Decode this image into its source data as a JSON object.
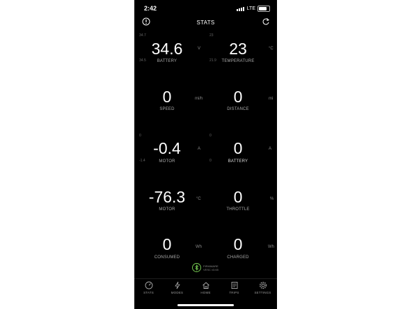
{
  "status": {
    "time": "2:42",
    "network": "LTE"
  },
  "header": {
    "title": "STATS"
  },
  "metrics": {
    "battery_voltage": {
      "value": "34.6",
      "label": "BATTERY",
      "unit": "V",
      "max": "34.7",
      "min": "34.5"
    },
    "temperature": {
      "value": "23",
      "label": "TEMPERATURE",
      "unit": "°C",
      "max": "23",
      "min": "21.9"
    },
    "speed": {
      "value": "0",
      "label": "SPEED",
      "unit": "mi/h"
    },
    "distance": {
      "value": "0",
      "label": "DISTANCE",
      "unit": "mi"
    },
    "motor_current": {
      "value": "-0.4",
      "label": "MOTOR",
      "unit": "A",
      "max": "0",
      "min": "-1.4"
    },
    "battery_current": {
      "value": "0",
      "label": "BATTERY",
      "unit": "A",
      "max": "0",
      "min": "0"
    },
    "motor_temp": {
      "value": "-76.3",
      "label": "MOTOR",
      "unit": "°C"
    },
    "throttle": {
      "value": "0",
      "label": "THROTTLE",
      "unit": "%"
    },
    "consumed": {
      "value": "0",
      "label": "CONSUMED",
      "unit": "Wh"
    },
    "charged": {
      "value": "0",
      "label": "CHARGED",
      "unit": "Wh"
    }
  },
  "firmware": {
    "line1": "FIRMWARE",
    "line2": "VESC v3.65"
  },
  "tabs": [
    {
      "label": "STATS",
      "icon": "gauge-icon"
    },
    {
      "label": "MODES",
      "icon": "lightning-icon"
    },
    {
      "label": "HOME",
      "icon": "home-icon"
    },
    {
      "label": "TRIPS",
      "icon": "map-icon"
    },
    {
      "label": "SETTINGS",
      "icon": "gear-icon"
    }
  ],
  "colors": {
    "background": "#000000",
    "bluetooth_accent": "#7ed957"
  }
}
